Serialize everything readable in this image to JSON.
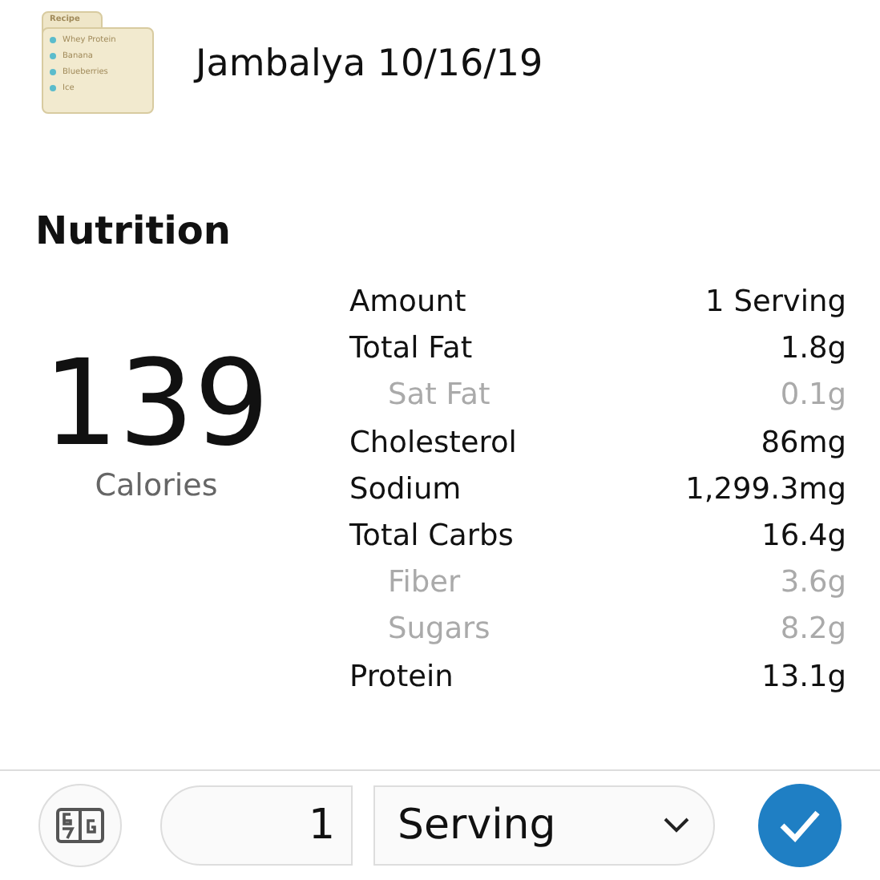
{
  "recipe_icon": {
    "title": "Recipe",
    "items": [
      "Whey Protein",
      "Banana",
      "Blueberries",
      "Ice"
    ]
  },
  "title": "Jambalya 10/16/19",
  "section_title": "Nutrition",
  "calories": {
    "value": "139",
    "label": "Calories"
  },
  "table": {
    "header": {
      "label": "Amount",
      "value": "1 Serving"
    },
    "rows": [
      {
        "label": "Total Fat",
        "value": "1.8g",
        "kind": "main"
      },
      {
        "label": "Sat Fat",
        "value": "0.1g",
        "kind": "sub"
      },
      {
        "label": "Cholesterol",
        "value": "86mg",
        "kind": "main"
      },
      {
        "label": "Sodium",
        "value": "1,299.3mg",
        "kind": "main"
      },
      {
        "label": "Total Carbs",
        "value": "16.4g",
        "kind": "main"
      },
      {
        "label": "Fiber",
        "value": "3.6g",
        "kind": "sub"
      },
      {
        "label": "Sugars",
        "value": "8.2g",
        "kind": "sub"
      },
      {
        "label": "Protein",
        "value": "13.1g",
        "kind": "main"
      }
    ]
  },
  "bottom_bar": {
    "quantity": "1",
    "unit": "Serving"
  }
}
